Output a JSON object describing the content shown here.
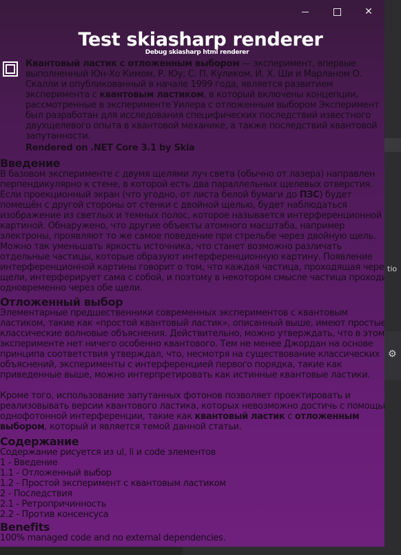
{
  "window": {
    "minimize": "",
    "maximize": "",
    "close": "✕"
  },
  "header": {
    "title": "Test skiasharp renderer",
    "subtitle": "Debug skiasharp html renderer"
  },
  "intro": {
    "bold1": "Квантовый ластик с отложенным выбором",
    "text1": " — эксперимент, впервые выполненный Юн-Хо Кимом, Р. Юу, С. П. Куликом, Й. Х. Ши и Марланом О. Скалли и опубликованный в начале 1999 года, является развитием эксперимента с ",
    "bold2": "квантовым ластиком",
    "text2": ", в который включены концепции, рассмотренные в эксперименте Уилера с отложенным выбором Эксперимент был разработан для исследования специфических последствий известного двухщелевого опыта в квантовой механике, а также последствий квантовой запутанности.",
    "rendered": "Rendered on .NET Core 3.1 by Skia"
  },
  "section1": {
    "heading": "Введение",
    "text_a": "В базовом эксперименте с двумя щелями луч света (обычно от лазера) направлен перпендикулярно к стене, в которой есть два параллельных щелевых отверстия. Если проекционный экран (что угодно, от листа белой бумаги до ",
    "bold": "ПЗС",
    "text_b": ") будет помещён с другой стороны от стенки с двойной щелью, будет наблюдаться изображение из светлых и темных полос, которое называется интерференционной картиной. Обнаружено, что другие объекты атомного масштаба, например электроны, проявляют то же самое поведение при стрельбе через двойную щель. Можно так уменьшать яркость источника, что станет возможно различать отдельные частицы, которые образуют интерференционную картину. Появление интерференционной картины говорит о том, что каждая частица, проходящая через щели, интерферирует сама с собой, и поэтому в некотором смысле частица проходит одновременно через обе щели."
  },
  "section2": {
    "heading": "Отложенный выбор",
    "text1": "Элементарные предшественники современных экспериментов с квантовым ластиком, такие как «простой квантовый ластик», описанный выше, имеют простые классические волновые объяснения. Действительно, можно утверждать, что в этом эксперименте нет ничего особенно квантового. Тем не менее Джордан на основе принципа соответствия утверждал, что, несмотря на существование классических объяснений, эксперименты с интерференцией первого порядка, такие как приведенные выше, можно интерпретировать как истинные квантовые ластики.",
    "text2a": "Кроме того, использование запутанных фотонов позволяет проектировать и реализовывать версии квантового ластика, которых невозможно достичь с помощью однофотонной интерференции, такие как ",
    "bold1": "квантовый ластик",
    "text2b": " с ",
    "bold2": "отложенным выбором",
    "text2c": ", который и является темой данной статьи."
  },
  "section3": {
    "heading": "Содержание",
    "intro": "Содержание рисуется из ul, li и code элементов",
    "items": [
      "1 - Введение",
      "1.1 - Отложенный выбор",
      "1.2 - Простой эксперимент с квантовым ластиком",
      "2 - Последствия",
      "2.1 - Ретропричинность",
      "2.2 - Против консенсуса"
    ]
  },
  "section4": {
    "heading": "Benefits",
    "text": "100% managed code and no external dependencies."
  },
  "ide": {
    "fragment": "tio",
    "gear": "⚙",
    "status": ""
  }
}
